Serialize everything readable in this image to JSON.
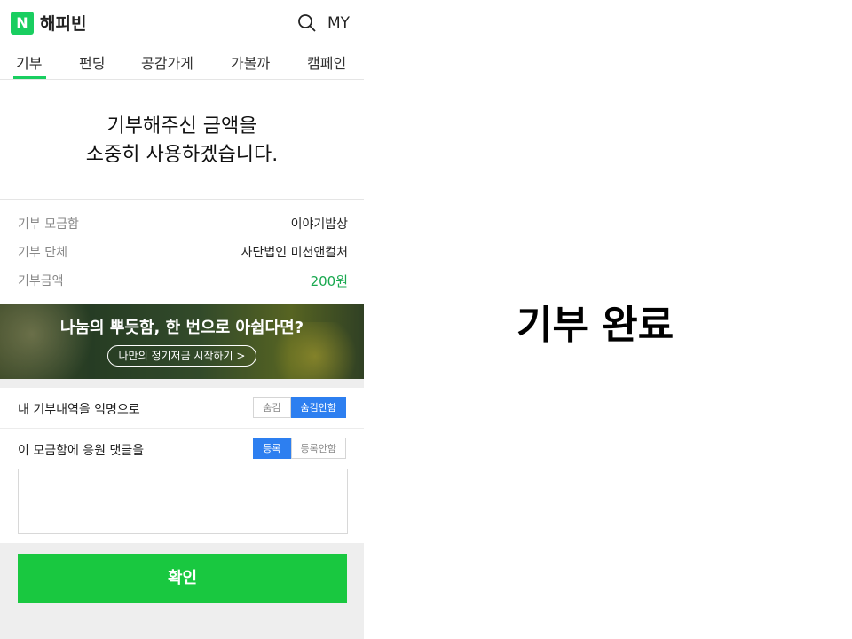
{
  "header": {
    "logo": "N",
    "brand": "해피빈",
    "search_icon": "search-icon",
    "my": "MY"
  },
  "tabs": [
    {
      "label": "기부",
      "active": true
    },
    {
      "label": "펀딩",
      "active": false
    },
    {
      "label": "공감가게",
      "active": false
    },
    {
      "label": "가볼까",
      "active": false
    },
    {
      "label": "캠페인",
      "active": false
    }
  ],
  "thanks": {
    "line1": "기부해주신 금액을",
    "line2": "소중히 사용하겠습니다."
  },
  "donation_info": [
    {
      "label": "기부 모금함",
      "value": "이야기밥상"
    },
    {
      "label": "기부 단체",
      "value": "사단법인 미션앤컬처"
    },
    {
      "label": "기부금액",
      "value": "200원"
    }
  ],
  "banner": {
    "title": "나눔의 뿌듯함, 한 번으로 아쉽다면?",
    "button": "나만의 정기저금 시작하기 >"
  },
  "anonymous": {
    "label": "내 기부내역을 익명으로",
    "options": [
      "숨김",
      "숨김안함"
    ],
    "selected": "숨김안함"
  },
  "comment": {
    "label": "이 모금함에 응원 댓글을",
    "options": [
      "등록",
      "등록안함"
    ],
    "selected": "등록",
    "value": ""
  },
  "confirm_label": "확인",
  "side_title": "기부 완료",
  "colors": {
    "brand_green": "#19ce60",
    "confirm_green": "#19c840",
    "toggle_blue": "#2d7ff0",
    "amount_green": "#19a84f"
  }
}
